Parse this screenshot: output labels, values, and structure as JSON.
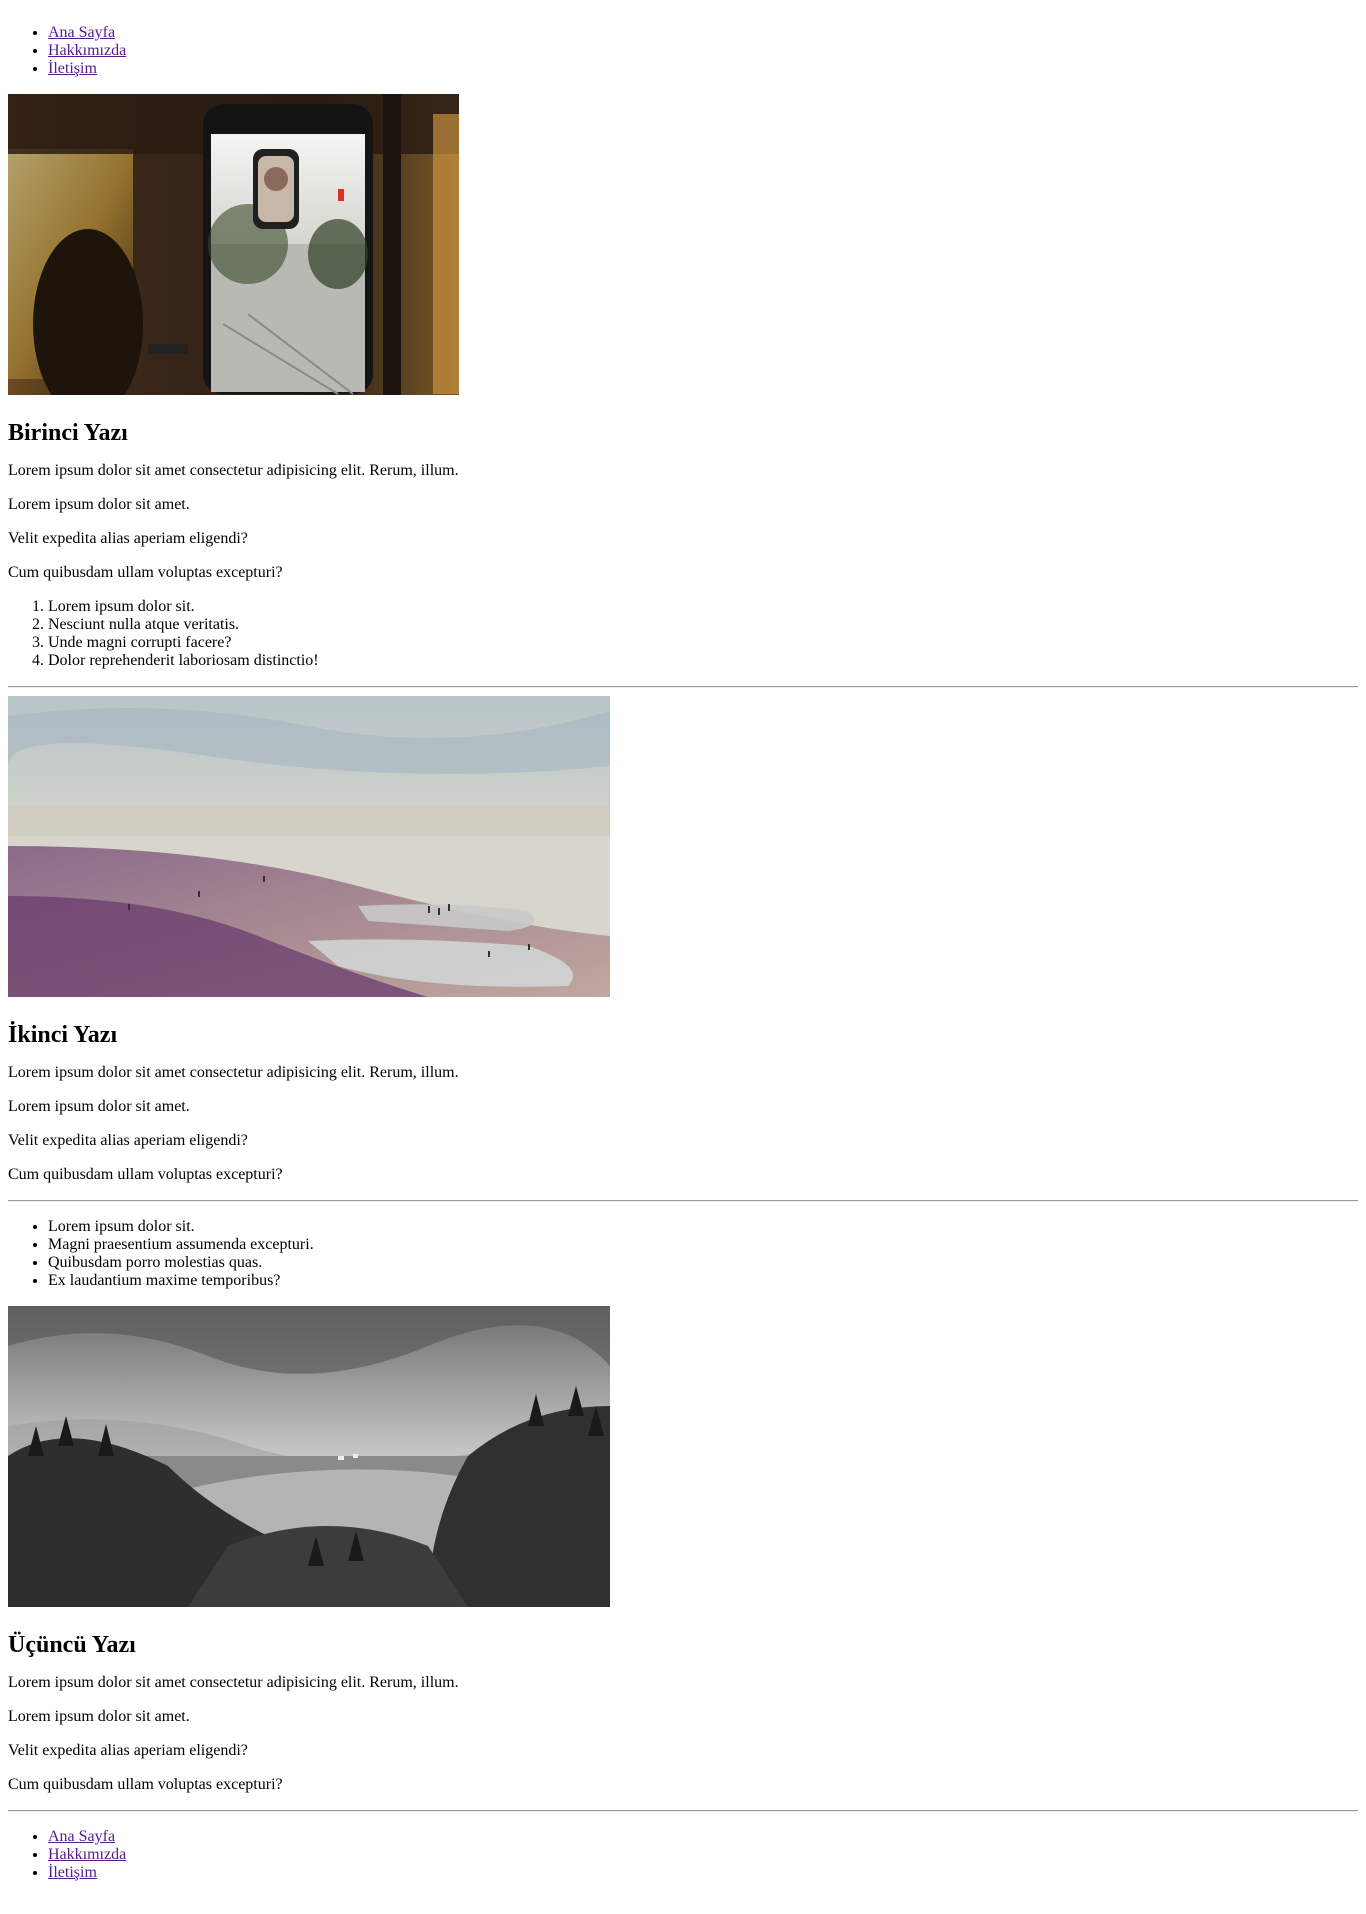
{
  "nav_top": {
    "items": [
      "Ana Sayfa",
      "Hakkımızda",
      "İletişim"
    ]
  },
  "posts": [
    {
      "title": "Birinci Yazı",
      "paragraphs": [
        "Lorem ipsum dolor sit amet consectetur adipisicing elit. Rerum, illum.",
        "Lorem ipsum dolor sit amet.",
        "Velit expedita alias aperiam eligendi?",
        "Cum quibusdam ullam voluptas excepturi?"
      ],
      "list": [
        "Lorem ipsum dolor sit.",
        "Nesciunt nulla atque veritatis.",
        "Unde magni corrupti facere?",
        "Dolor reprehenderit laboriosam distinctio!"
      ]
    },
    {
      "title": "İkinci Yazı",
      "paragraphs": [
        "Lorem ipsum dolor sit amet consectetur adipisicing elit. Rerum, illum.",
        "Lorem ipsum dolor sit amet.",
        "Velit expedita alias aperiam eligendi?",
        "Cum quibusdam ullam voluptas excepturi?"
      ],
      "list": [
        "Lorem ipsum dolor sit.",
        "Magni praesentium assumenda excepturi.",
        "Quibusdam porro molestias quas.",
        "Ex laudantium maxime temporibus?"
      ]
    },
    {
      "title": "Üçüncü Yazı",
      "paragraphs": [
        "Lorem ipsum dolor sit amet consectetur adipisicing elit. Rerum, illum.",
        "Lorem ipsum dolor sit amet.",
        "Velit expedita alias aperiam eligendi?",
        "Cum quibusdam ullam voluptas excepturi?"
      ]
    }
  ],
  "nav_bottom": {
    "items": [
      "Ana Sayfa",
      "Hakkımızda",
      "İletişim"
    ]
  },
  "colors": {
    "link": "#551a8b",
    "rule": "#9a9a9a"
  }
}
